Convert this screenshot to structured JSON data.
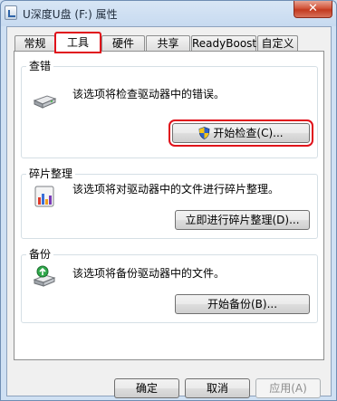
{
  "window": {
    "title": "U深度U盘 (F:) 属性",
    "close_label": "✕"
  },
  "tabs": [
    {
      "label": "常规",
      "active": false
    },
    {
      "label": "工具",
      "active": true
    },
    {
      "label": "硬件",
      "active": false
    },
    {
      "label": "共享",
      "active": false
    },
    {
      "label": "ReadyBoost",
      "active": false
    },
    {
      "label": "自定义",
      "active": false
    }
  ],
  "groups": {
    "error_check": {
      "title": "查错",
      "description": "该选项将检查驱动器中的错误。",
      "button_label": "开始检查(C)...",
      "icon": "drive-icon"
    },
    "defrag": {
      "title": "碎片整理",
      "description": "该选项将对驱动器中的文件进行碎片整理。",
      "button_label": "立即进行碎片整理(D)...",
      "icon": "defrag-icon"
    },
    "backup": {
      "title": "备份",
      "description": "该选项将备份驱动器中的文件。",
      "button_label": "开始备份(B)...",
      "icon": "backup-icon"
    }
  },
  "footer": {
    "ok_label": "确定",
    "cancel_label": "取消",
    "apply_label": "应用(A)"
  },
  "colors": {
    "highlight": "#e0101a",
    "title_bar": "#c7daf0"
  }
}
